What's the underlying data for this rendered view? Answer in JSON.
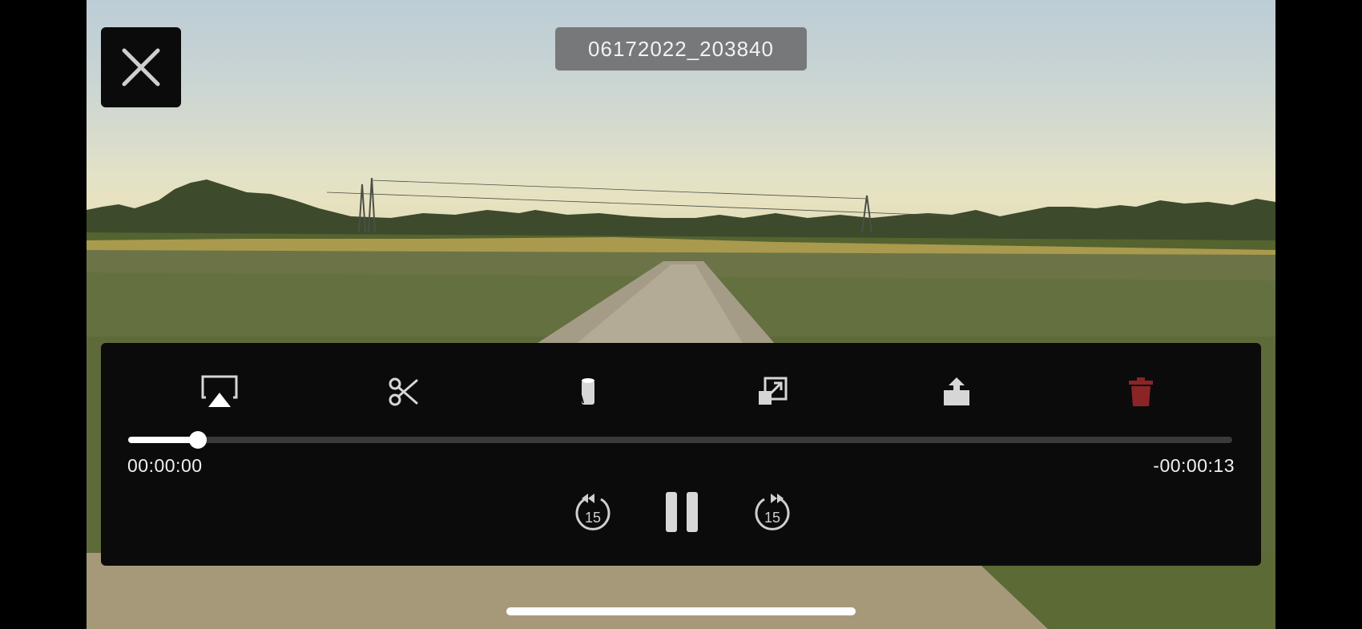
{
  "video": {
    "title": "06172022_203840"
  },
  "toolbar": {
    "icons": [
      "airplay-icon",
      "scissors-icon",
      "can-icon",
      "resize-icon",
      "share-icon",
      "trash-icon"
    ]
  },
  "playback": {
    "progress": 0.063,
    "elapsed": "00:00:00",
    "remaining": "-00:00:13",
    "skip_back_label": "15",
    "skip_forward_label": "15",
    "state": "playing"
  },
  "colors": {
    "panel": "#0b0b0b",
    "delete_red": "#8b2426",
    "icon_gray": "#b8b8b8"
  }
}
